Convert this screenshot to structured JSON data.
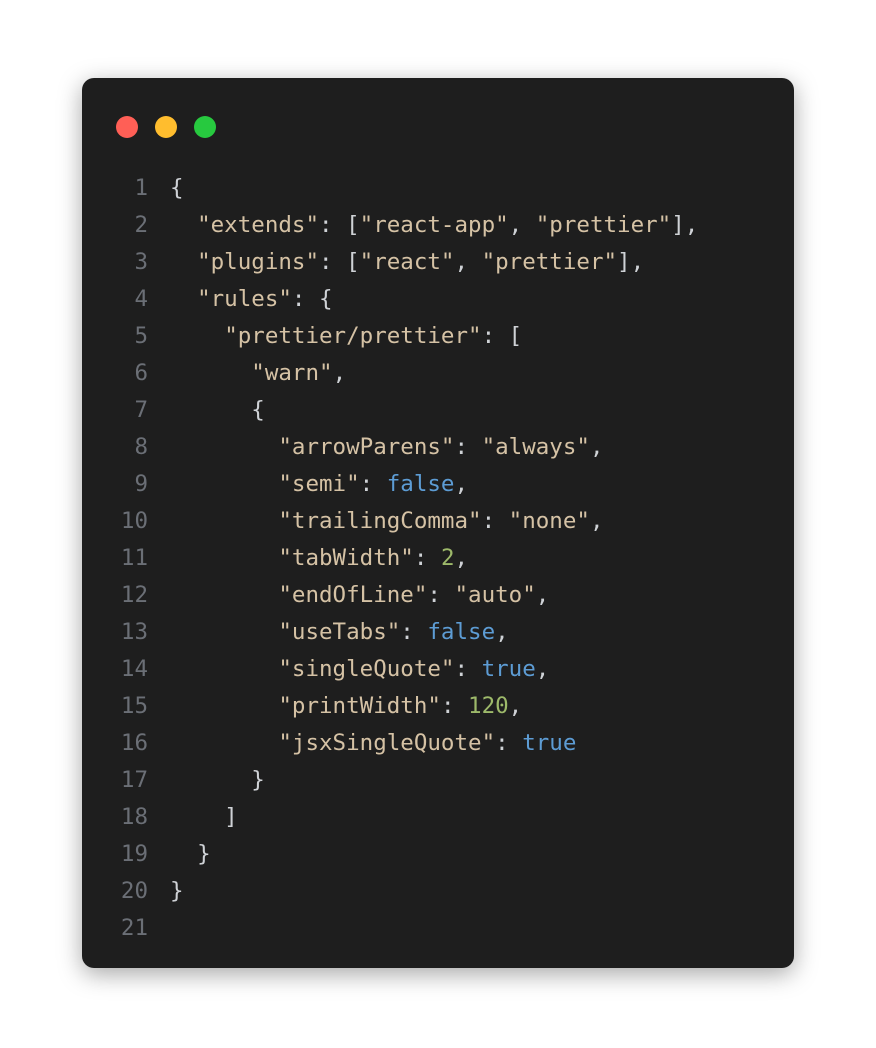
{
  "window": {
    "dots": [
      "close",
      "minimize",
      "maximize"
    ]
  },
  "code": {
    "language": "json",
    "lines": [
      {
        "n": 1,
        "tokens": [
          {
            "t": "{",
            "c": "p"
          }
        ]
      },
      {
        "n": 2,
        "tokens": [
          {
            "t": "  ",
            "c": "p"
          },
          {
            "t": "\"extends\"",
            "c": "key"
          },
          {
            "t": ": [",
            "c": "p"
          },
          {
            "t": "\"react-app\"",
            "c": "str"
          },
          {
            "t": ", ",
            "c": "p"
          },
          {
            "t": "\"prettier\"",
            "c": "str"
          },
          {
            "t": "],",
            "c": "p"
          }
        ]
      },
      {
        "n": 3,
        "tokens": [
          {
            "t": "  ",
            "c": "p"
          },
          {
            "t": "\"plugins\"",
            "c": "key"
          },
          {
            "t": ": [",
            "c": "p"
          },
          {
            "t": "\"react\"",
            "c": "str"
          },
          {
            "t": ", ",
            "c": "p"
          },
          {
            "t": "\"prettier\"",
            "c": "str"
          },
          {
            "t": "],",
            "c": "p"
          }
        ]
      },
      {
        "n": 4,
        "tokens": [
          {
            "t": "  ",
            "c": "p"
          },
          {
            "t": "\"rules\"",
            "c": "key"
          },
          {
            "t": ": {",
            "c": "p"
          }
        ]
      },
      {
        "n": 5,
        "tokens": [
          {
            "t": "    ",
            "c": "p"
          },
          {
            "t": "\"prettier/prettier\"",
            "c": "key"
          },
          {
            "t": ": [",
            "c": "p"
          }
        ]
      },
      {
        "n": 6,
        "tokens": [
          {
            "t": "      ",
            "c": "p"
          },
          {
            "t": "\"warn\"",
            "c": "str"
          },
          {
            "t": ",",
            "c": "p"
          }
        ]
      },
      {
        "n": 7,
        "tokens": [
          {
            "t": "      {",
            "c": "p"
          }
        ]
      },
      {
        "n": 8,
        "tokens": [
          {
            "t": "        ",
            "c": "p"
          },
          {
            "t": "\"arrowParens\"",
            "c": "key"
          },
          {
            "t": ": ",
            "c": "p"
          },
          {
            "t": "\"always\"",
            "c": "str"
          },
          {
            "t": ",",
            "c": "p"
          }
        ]
      },
      {
        "n": 9,
        "tokens": [
          {
            "t": "        ",
            "c": "p"
          },
          {
            "t": "\"semi\"",
            "c": "key"
          },
          {
            "t": ": ",
            "c": "p"
          },
          {
            "t": "false",
            "c": "bool"
          },
          {
            "t": ",",
            "c": "p"
          }
        ]
      },
      {
        "n": 10,
        "tokens": [
          {
            "t": "        ",
            "c": "p"
          },
          {
            "t": "\"trailingComma\"",
            "c": "key"
          },
          {
            "t": ": ",
            "c": "p"
          },
          {
            "t": "\"none\"",
            "c": "str"
          },
          {
            "t": ",",
            "c": "p"
          }
        ]
      },
      {
        "n": 11,
        "tokens": [
          {
            "t": "        ",
            "c": "p"
          },
          {
            "t": "\"tabWidth\"",
            "c": "key"
          },
          {
            "t": ": ",
            "c": "p"
          },
          {
            "t": "2",
            "c": "num"
          },
          {
            "t": ",",
            "c": "p"
          }
        ]
      },
      {
        "n": 12,
        "tokens": [
          {
            "t": "        ",
            "c": "p"
          },
          {
            "t": "\"endOfLine\"",
            "c": "key"
          },
          {
            "t": ": ",
            "c": "p"
          },
          {
            "t": "\"auto\"",
            "c": "str"
          },
          {
            "t": ",",
            "c": "p"
          }
        ]
      },
      {
        "n": 13,
        "tokens": [
          {
            "t": "        ",
            "c": "p"
          },
          {
            "t": "\"useTabs\"",
            "c": "key"
          },
          {
            "t": ": ",
            "c": "p"
          },
          {
            "t": "false",
            "c": "bool"
          },
          {
            "t": ",",
            "c": "p"
          }
        ]
      },
      {
        "n": 14,
        "tokens": [
          {
            "t": "        ",
            "c": "p"
          },
          {
            "t": "\"singleQuote\"",
            "c": "key"
          },
          {
            "t": ": ",
            "c": "p"
          },
          {
            "t": "true",
            "c": "bool"
          },
          {
            "t": ",",
            "c": "p"
          }
        ]
      },
      {
        "n": 15,
        "tokens": [
          {
            "t": "        ",
            "c": "p"
          },
          {
            "t": "\"printWidth\"",
            "c": "key"
          },
          {
            "t": ": ",
            "c": "p"
          },
          {
            "t": "120",
            "c": "num"
          },
          {
            "t": ",",
            "c": "p"
          }
        ]
      },
      {
        "n": 16,
        "tokens": [
          {
            "t": "        ",
            "c": "p"
          },
          {
            "t": "\"jsxSingleQuote\"",
            "c": "key"
          },
          {
            "t": ": ",
            "c": "p"
          },
          {
            "t": "true",
            "c": "bool"
          }
        ]
      },
      {
        "n": 17,
        "tokens": [
          {
            "t": "      }",
            "c": "p"
          }
        ]
      },
      {
        "n": 18,
        "tokens": [
          {
            "t": "    ]",
            "c": "p"
          }
        ]
      },
      {
        "n": 19,
        "tokens": [
          {
            "t": "  }",
            "c": "p"
          }
        ]
      },
      {
        "n": 20,
        "tokens": [
          {
            "t": "}",
            "c": "p"
          }
        ]
      },
      {
        "n": 21,
        "tokens": []
      }
    ]
  }
}
